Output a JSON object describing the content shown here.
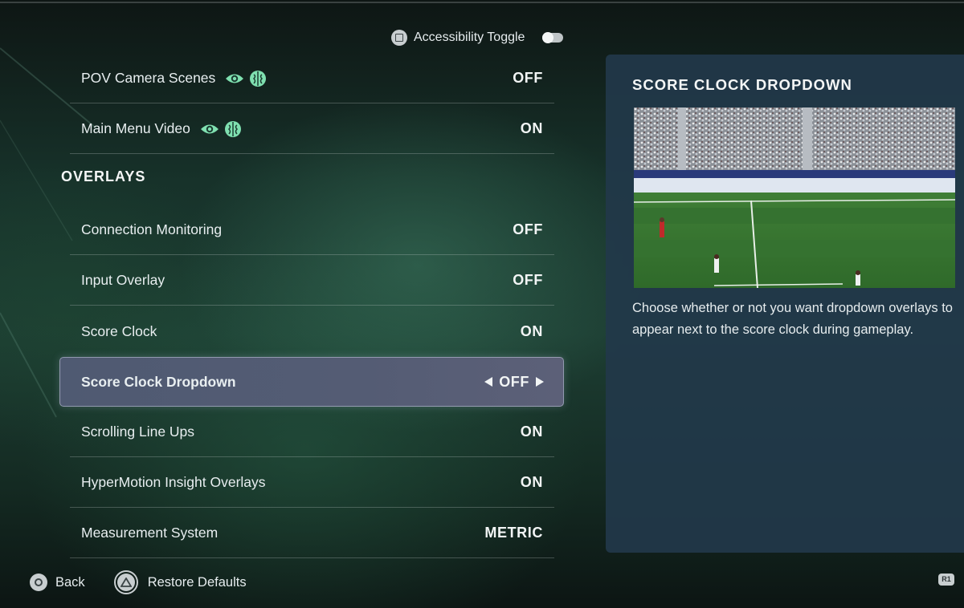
{
  "accessibility_toggle": {
    "label": "Accessibility Toggle",
    "enabled": false
  },
  "camera_rows": [
    {
      "label": "POV Camera Scenes",
      "value": "OFF",
      "icons": [
        "eye-icon",
        "brain-icon"
      ]
    },
    {
      "label": "Main Menu Video",
      "value": "ON",
      "icons": [
        "eye-icon",
        "brain-icon"
      ]
    }
  ],
  "overlays": {
    "heading": "OVERLAYS",
    "rows": [
      {
        "label": "Connection Monitoring",
        "value": "OFF"
      },
      {
        "label": "Input Overlay",
        "value": "OFF"
      },
      {
        "label": "Score Clock",
        "value": "ON"
      },
      {
        "label": "Score Clock Dropdown",
        "value": "OFF",
        "selected": true
      },
      {
        "label": "Scrolling Line Ups",
        "value": "ON"
      },
      {
        "label": "HyperMotion Insight Overlays",
        "value": "ON"
      },
      {
        "label": "Measurement System",
        "value": "METRIC"
      }
    ]
  },
  "panel": {
    "title": "SCORE CLOCK DROPDOWN",
    "description": "Choose whether or not you want dropdown overlays to appear next to the score clock during gameplay.",
    "preview_icon": "stadium-preview-image"
  },
  "footer": {
    "back_label": "Back",
    "restore_label": "Restore Defaults",
    "r1_label": "R1"
  },
  "colors": {
    "accent_icon": "#7fe0b0",
    "panel_bg": "#22384a",
    "selected_row": "#525a72"
  }
}
